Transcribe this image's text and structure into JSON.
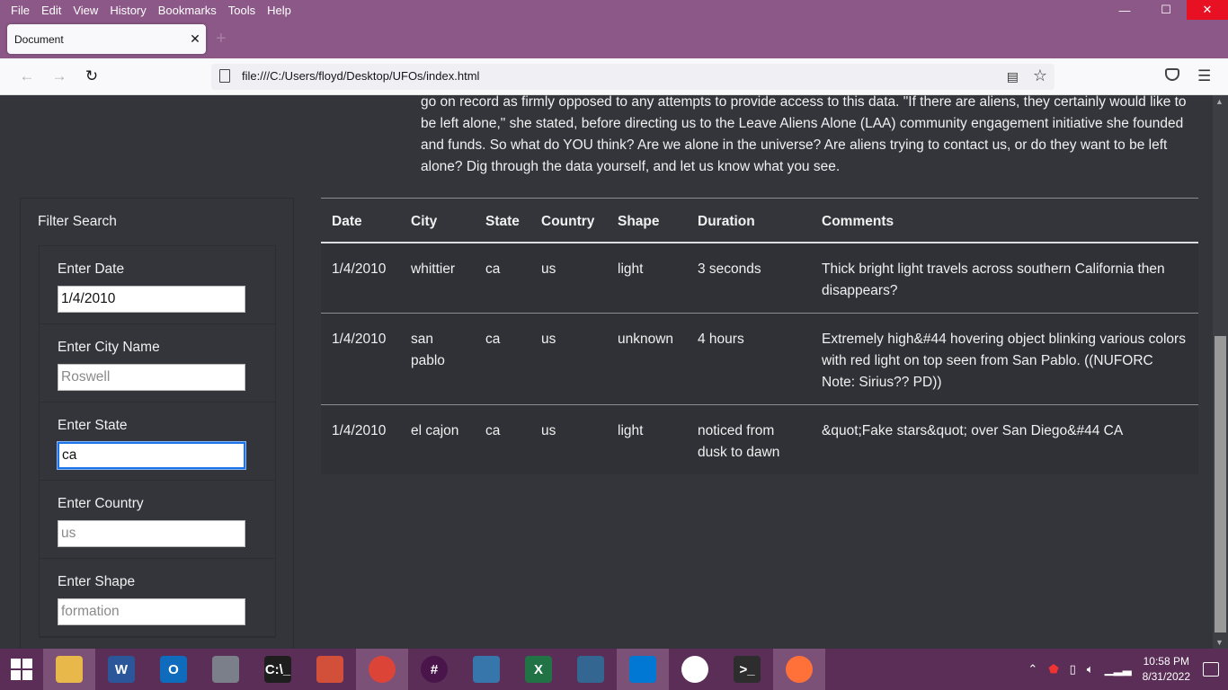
{
  "menubar": {
    "items": [
      "File",
      "Edit",
      "View",
      "History",
      "Bookmarks",
      "Tools",
      "Help"
    ]
  },
  "window_controls": {
    "minimize": "—",
    "maximize": "☐",
    "close": "✕"
  },
  "tab": {
    "title": "Document",
    "close": "✕",
    "new_tab": "+"
  },
  "navbar": {
    "url": "file:///C:/Users/floyd/Desktop/UFOs/index.html"
  },
  "intro": {
    "text": "go on record as firmly opposed to any attempts to provide access to this data. \"If there are aliens, they certainly would like to be left alone,\" she stated, before directing us to the Leave Aliens Alone (LAA) community engagement initiative she founded and funds. So what do YOU think? Are we alone in the universe? Are aliens trying to contact us, or do they want to be left alone? Dig through the data yourself, and let us know what you see."
  },
  "filters": {
    "title": "Filter Search",
    "date": {
      "label": "Enter Date",
      "value": "1/4/2010",
      "placeholder": ""
    },
    "city": {
      "label": "Enter City Name",
      "value": "",
      "placeholder": "Roswell"
    },
    "state": {
      "label": "Enter State",
      "value": "ca",
      "placeholder": ""
    },
    "country": {
      "label": "Enter Country",
      "value": "",
      "placeholder": "us"
    },
    "shape": {
      "label": "Enter Shape",
      "value": "",
      "placeholder": "formation"
    }
  },
  "table": {
    "headers": [
      "Date",
      "City",
      "State",
      "Country",
      "Shape",
      "Duration",
      "Comments"
    ],
    "rows": [
      [
        "1/4/2010",
        "whittier",
        "ca",
        "us",
        "light",
        "3 seconds",
        "Thick bright light travels across southern California then disappears?"
      ],
      [
        "1/4/2010",
        "san pablo",
        "ca",
        "us",
        "unknown",
        "4 hours",
        "Extremely high&#44 hovering object blinking various colors with red light on top seen from San Pablo. ((NUFORC Note: Sirius?? PD))"
      ],
      [
        "1/4/2010",
        "el cajon",
        "ca",
        "us",
        "light",
        "noticed from dusk to dawn",
        "&quot;Fake stars&quot; over San Diego&#44 CA"
      ]
    ]
  },
  "taskbar": {
    "apps": [
      {
        "name": "file-explorer",
        "label": "",
        "color": "#e8b84a"
      },
      {
        "name": "word",
        "label": "W",
        "color": "#2b579a"
      },
      {
        "name": "outlook",
        "label": "O",
        "color": "#0f6cbd"
      },
      {
        "name": "calculator",
        "label": "",
        "color": "#7a7f8a"
      },
      {
        "name": "command-prompt",
        "label": "C:\\_",
        "color": "#1e1e1e"
      },
      {
        "name": "git",
        "label": "",
        "color": "#d24f3a"
      },
      {
        "name": "chrome",
        "label": "",
        "color": "#db4437"
      },
      {
        "name": "slack",
        "label": "#",
        "color": "#4a154b"
      },
      {
        "name": "python",
        "label": "",
        "color": "#3776ab"
      },
      {
        "name": "excel",
        "label": "X",
        "color": "#217346"
      },
      {
        "name": "postgresql",
        "label": "",
        "color": "#336791"
      },
      {
        "name": "vscode",
        "label": "",
        "color": "#0078d4"
      },
      {
        "name": "mongodb",
        "label": "",
        "color": "#13aa52"
      },
      {
        "name": "terminal",
        "label": ">_",
        "color": "#2d2d2d"
      },
      {
        "name": "firefox",
        "label": "",
        "color": "#ff7139"
      }
    ],
    "time": "10:58 PM",
    "date": "8/31/2022"
  }
}
